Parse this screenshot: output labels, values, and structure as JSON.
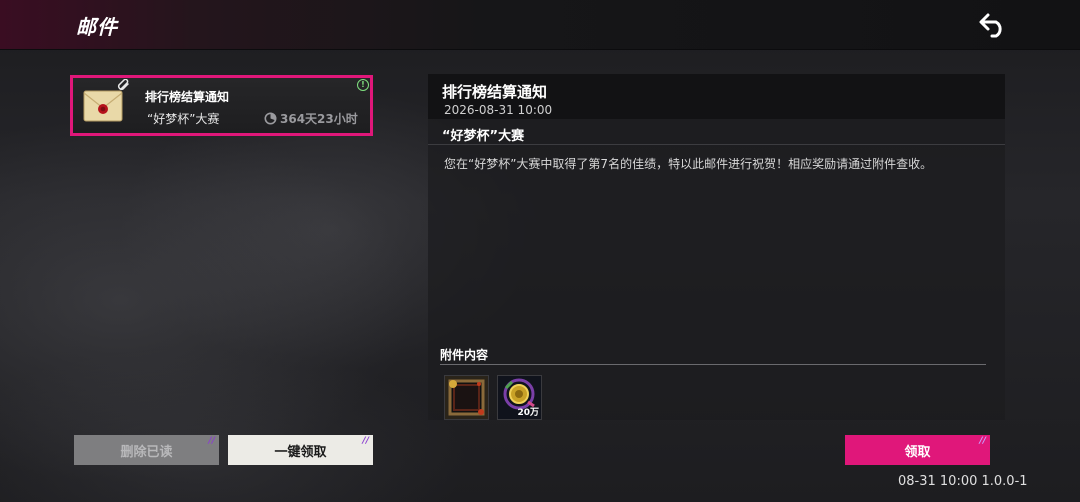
{
  "header": {
    "title": "邮件"
  },
  "mail_list": [
    {
      "title": "排行榜结算通知",
      "subtitle": "“好梦杯”大赛",
      "time_left": "364天23小时",
      "alert": "!"
    }
  ],
  "actions": {
    "delete_read": "删除已读",
    "claim_all": "一键领取",
    "claim": "领取"
  },
  "detail": {
    "title": "排行榜结算通知",
    "date": "2026-08-31 10:00",
    "subject": "“好梦杯”大赛",
    "body": "您在“好梦杯”大赛中取得了第7名的佳绩，特以此邮件进行祝贺！相应奖励请通过附件查收。",
    "attachments_label": "附件内容",
    "attachments": [
      {
        "icon": "avatar-frame-icon",
        "quantity": ""
      },
      {
        "icon": "gold-coin-icon",
        "quantity": "20万"
      }
    ]
  },
  "footer": {
    "version": "08-31 10:00 1.0.0-1"
  },
  "colors": {
    "accent": "#e0177a",
    "claim_all_bg": "#ecebe6",
    "delete_bg": "#7e7e80",
    "header_bg": "#121214"
  }
}
